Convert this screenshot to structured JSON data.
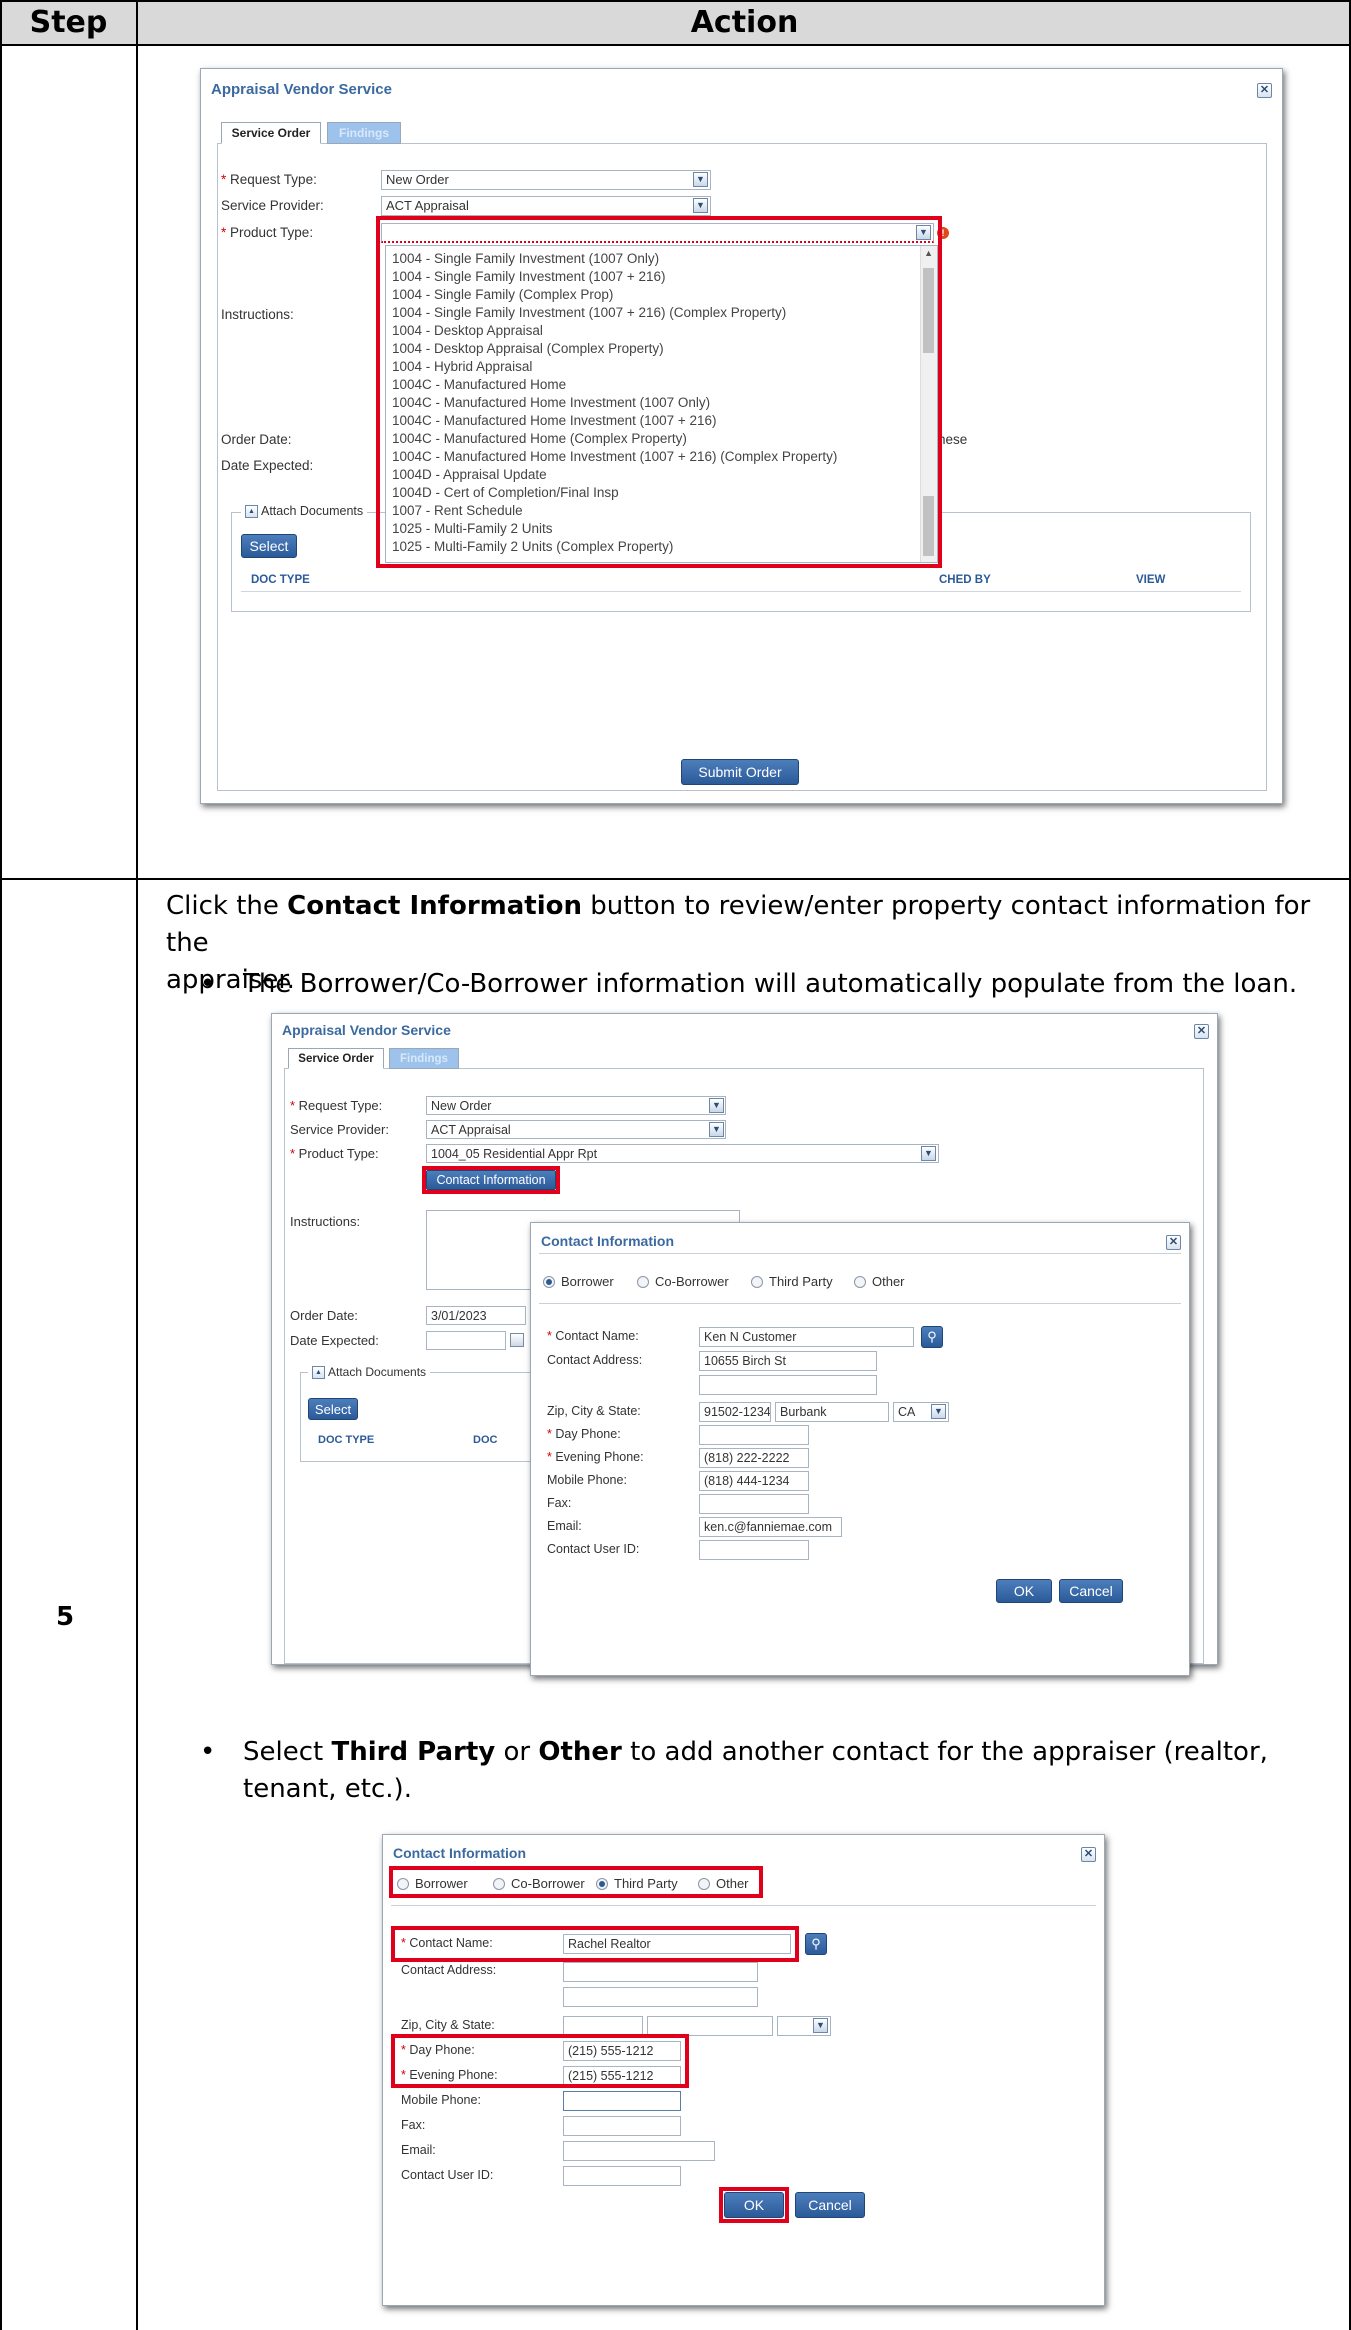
{
  "table": {
    "header_step": "Step",
    "header_action": "Action",
    "step_number": "5"
  },
  "instructions": {
    "para_pre": "Click the ",
    "para_bold": "Contact Information",
    "para_post": " button to review/enter property contact information for the",
    "para_line2": "appraiser.",
    "bullet1": "The Borrower/Co-Borrower information will automatically populate from the loan.",
    "bullet2_pre": "Select ",
    "bullet2_bold1": "Third Party",
    "bullet2_mid": " or ",
    "bullet2_bold2": "Other",
    "bullet2_post": " to add another contact for the appraiser (realtor,",
    "bullet2_line2": "tenant, etc.)."
  },
  "shot1": {
    "title": "Appraisal Vendor Service",
    "tab_service_order": "Service Order",
    "tab_findings": "Findings",
    "label_request_type": "Request Type:",
    "value_request_type": "New Order",
    "label_service_provider": "Service Provider:",
    "value_service_provider": "ACT Appraisal",
    "label_product_type": "Product Type:",
    "value_product_type": "",
    "label_instructions": "Instructions:",
    "label_order_date": "Order Date:",
    "label_date_expected": "Date Expected:",
    "label_attach_documents": "Attach Documents",
    "select_button": "Select",
    "col_doc_type": "DOC TYPE",
    "col_attached_by_partial": "CHED BY",
    "col_view": "VIEW",
    "partial_text_these": "hese",
    "submit_button": "Submit Order",
    "product_options": [
      "1004 - Single Family Investment (1007 Only)",
      "1004 - Single Family Investment (1007 + 216)",
      "1004 - Single Family (Complex Prop)",
      "1004 - Single Family Investment (1007 + 216) (Complex Property)",
      "1004 - Desktop Appraisal",
      "1004 - Desktop Appraisal (Complex Property)",
      "1004 - Hybrid Appraisal",
      "1004C - Manufactured Home",
      "1004C - Manufactured Home Investment (1007 Only)",
      "1004C - Manufactured Home Investment (1007 + 216)",
      "1004C - Manufactured Home (Complex Property)",
      "1004C - Manufactured Home Investment (1007 + 216) (Complex Property)",
      "1004D - Appraisal Update",
      "1004D - Cert of Completion/Final Insp",
      "1007 - Rent Schedule",
      "1025 - Multi-Family 2 Units",
      "1025 - Multi-Family 2 Units (Complex Property)"
    ]
  },
  "shot2": {
    "title": "Appraisal Vendor Service",
    "tab_service_order": "Service Order",
    "tab_findings": "Findings",
    "label_request_type": "Request Type:",
    "value_request_type": "New Order",
    "label_service_provider": "Service Provider:",
    "value_service_provider": "ACT Appraisal",
    "label_product_type": "Product Type:",
    "value_product_type": "1004_05 Residential Appr Rpt",
    "contact_info_button": "Contact Information",
    "label_instructions": "Instructions:",
    "label_order_date": "Order Date:",
    "value_order_date": "3/01/2023",
    "label_date_expected": "Date Expected:",
    "label_attach_documents": "Attach Documents",
    "select_button": "Select",
    "col_doc_type": "DOC TYPE",
    "col_doc_partial": "DOC",
    "contact": {
      "title": "Contact Information",
      "radio_borrower": "Borrower",
      "radio_coborrower": "Co-Borrower",
      "radio_thirdparty": "Third Party",
      "radio_other": "Other",
      "selected": "Borrower",
      "label_contact_name": "Contact Name:",
      "value_contact_name": "Ken N Customer",
      "label_contact_address": "Contact Address:",
      "value_address1": "10655 Birch St",
      "value_address2": "",
      "label_zip": "Zip, City & State:",
      "value_zip": "91502-1234",
      "value_city": "Burbank",
      "value_state": "CA",
      "label_day_phone": "Day Phone:",
      "value_day_phone": "",
      "label_evening_phone": "Evening Phone:",
      "value_evening_phone": "(818) 222-2222",
      "label_mobile_phone": "Mobile Phone:",
      "value_mobile_phone": "(818) 444-1234",
      "label_fax": "Fax:",
      "value_fax": "",
      "label_email": "Email:",
      "value_email": "ken.c@fanniemae.com",
      "label_user_id": "Contact User ID:",
      "value_user_id": "",
      "ok_button": "OK",
      "cancel_button": "Cancel"
    }
  },
  "shot3": {
    "title": "Contact Information",
    "radio_borrower": "Borrower",
    "radio_coborrower": "Co-Borrower",
    "radio_thirdparty": "Third Party",
    "radio_other": "Other",
    "selected": "Third Party",
    "label_contact_name": "Contact Name:",
    "value_contact_name": "Rachel Realtor",
    "label_contact_address": "Contact Address:",
    "label_zip": "Zip, City & State:",
    "label_day_phone": "Day Phone:",
    "value_day_phone": "(215) 555-1212",
    "label_evening_phone": "Evening Phone:",
    "value_evening_phone": "(215) 555-1212",
    "label_mobile_phone": "Mobile Phone:",
    "label_fax": "Fax:",
    "label_email": "Email:",
    "label_user_id": "Contact User ID:",
    "ok_button": "OK",
    "cancel_button": "Cancel"
  },
  "colors": {
    "highlight": "#e0001b",
    "header_bg": "#d9d9d9",
    "brand_blue": "#2b5a99"
  }
}
